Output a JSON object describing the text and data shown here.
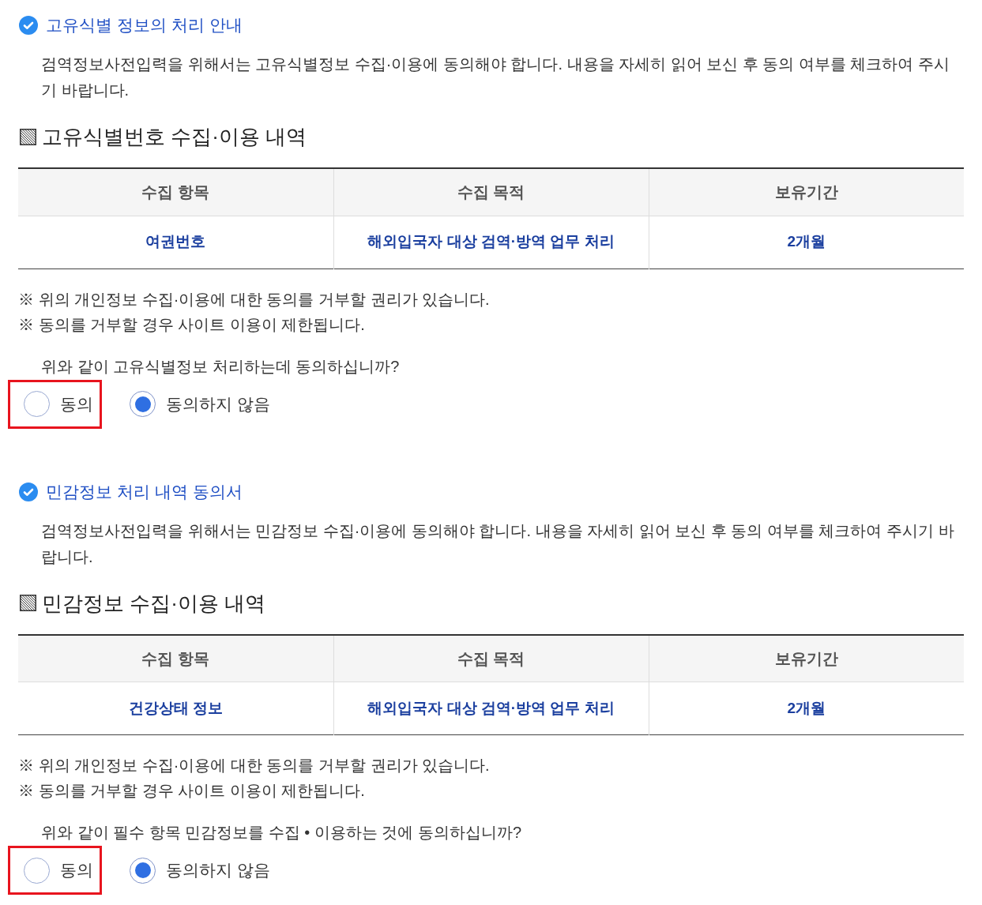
{
  "sections": [
    {
      "title": "고유식별 정보의 처리 안내",
      "description": "검역정보사전입력을 위해서는 고유식별정보 수집·이용에 동의해야 합니다. 내용을 자세히 읽어 보신 후 동의 여부를 체크하여 주시기 바랍니다.",
      "table_heading": "고유식별번호 수집·이용 내역",
      "table": {
        "columns": [
          "수집 항목",
          "수집 목적",
          "보유기간"
        ],
        "rows": [
          [
            "여권번호",
            "해외입국자 대상 검역·방역 업무 처리",
            "2개월"
          ]
        ]
      },
      "notes": [
        "※ 위의 개인정보 수집·이용에 대한 동의를 거부할 권리가 있습니다.",
        "※ 동의를 거부할 경우 사이트 이용이 제한됩니다."
      ],
      "question": "위와 같이 고유식별정보 처리하는데 동의하십니까?",
      "options": [
        {
          "label": "동의",
          "selected": false,
          "highlighted": true
        },
        {
          "label": "동의하지 않음",
          "selected": true,
          "highlighted": false
        }
      ]
    },
    {
      "title": "민감정보 처리 내역 동의서",
      "description": "검역정보사전입력을 위해서는 민감정보 수집·이용에 동의해야 합니다. 내용을 자세히 읽어 보신 후 동의 여부를 체크하여 주시기 바랍니다.",
      "table_heading": "민감정보 수집·이용 내역",
      "table": {
        "columns": [
          "수집 항목",
          "수집 목적",
          "보유기간"
        ],
        "rows": [
          [
            "건강상태 정보",
            "해외입국자 대상 검역·방역 업무 처리",
            "2개월"
          ]
        ]
      },
      "notes": [
        "※ 위의 개인정보 수집·이용에 대한 동의를 거부할 권리가 있습니다.",
        "※ 동의를 거부할 경우 사이트 이용이 제한됩니다."
      ],
      "question": "위와 같이 필수 항목 민감정보를 수집 • 이용하는 것에 동의하십니까?",
      "options": [
        {
          "label": "동의",
          "selected": false,
          "highlighted": true
        },
        {
          "label": "동의하지 않음",
          "selected": true,
          "highlighted": false
        }
      ]
    }
  ]
}
